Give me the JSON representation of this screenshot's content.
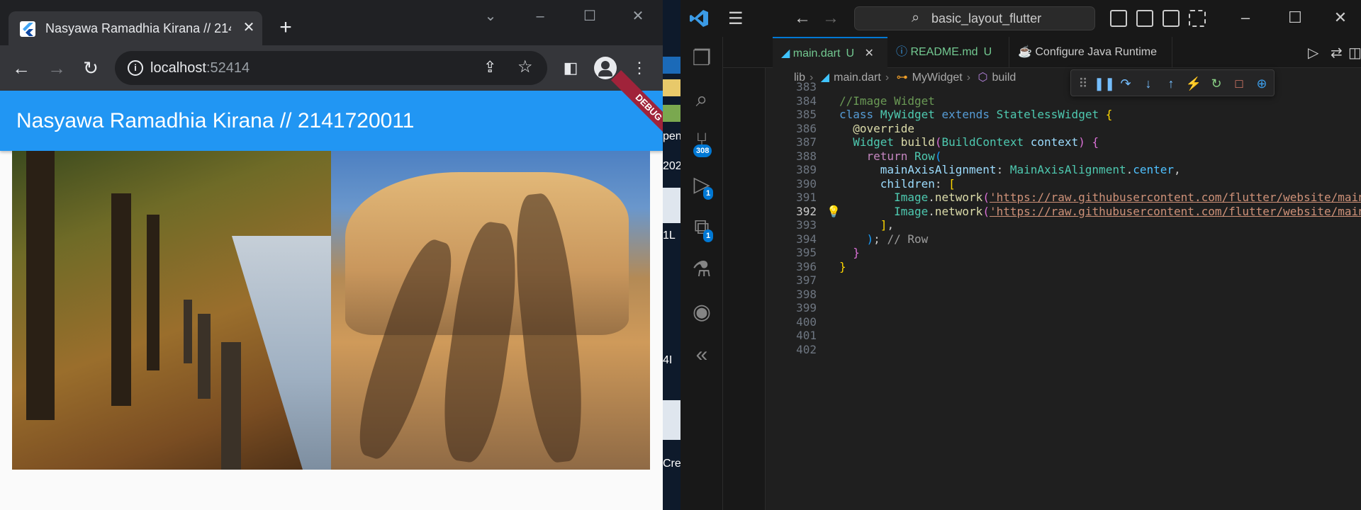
{
  "browser": {
    "tab_title": "Nasyawa Ramadhia Kirana // 214",
    "tab_close": "✕",
    "new_tab": "+",
    "url_host": "localhost",
    "url_port": ":52414",
    "app_title": "Nasyawa Ramadhia Kirana // 2141720011",
    "debug_banner": "DEBUG"
  },
  "desktop": {
    "items": [
      "pen",
      "202",
      "1L",
      "4I",
      "Cre"
    ]
  },
  "vscode": {
    "search_text": "basic_layout_flutter",
    "tabs": [
      {
        "label": "main.dart",
        "status": "U"
      },
      {
        "label": "README.md",
        "status": "U"
      },
      {
        "label": "Configure Java Runtime",
        "status": ""
      }
    ],
    "breadcrumbs": [
      "lib",
      "main.dart",
      "MyWidget",
      "build"
    ],
    "badges": {
      "source_control": "308",
      "run_debug": "1",
      "extensions": "1"
    },
    "line_numbers": [
      "383",
      "384",
      "385",
      "386",
      "387",
      "388",
      "389",
      "390",
      "391",
      "392",
      "393",
      "394",
      "395",
      "396",
      "397",
      "398",
      "399",
      "400",
      "401",
      "402"
    ],
    "active_line": "392"
  },
  "colors": {
    "appbar": "#2196f3",
    "debug_ribbon": "#a0233a",
    "vscode_accent": "#0078d4",
    "modified_file": "#73c991"
  }
}
